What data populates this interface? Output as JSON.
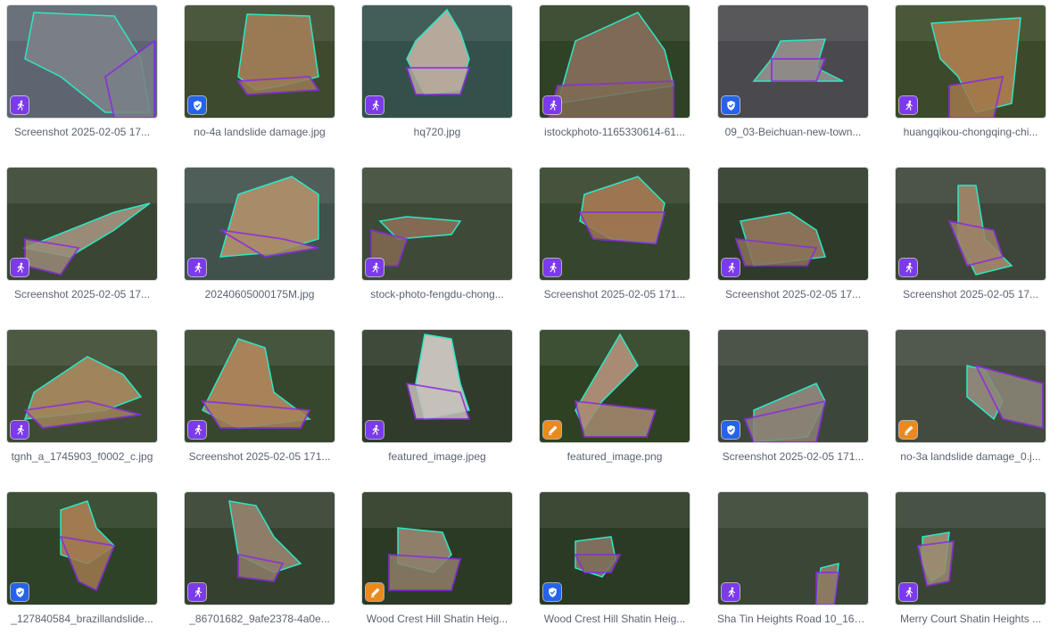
{
  "colors": {
    "annotation_badge": "#7c3aed",
    "reviewed_badge": "#2563eb",
    "edit_badge": "#ea8a1e",
    "outline_teal": "#2ee6c4",
    "outline_purple": "#8b2be2"
  },
  "items": [
    {
      "name": "Screenshot 2025-02-05 17...",
      "status": "annotate",
      "icon": "running-person-icon",
      "bg": "#5d6570",
      "scene": "#7a7f86"
    },
    {
      "name": "no-4a landslide damage.jpg",
      "status": "reviewed",
      "icon": "shield-check-icon",
      "bg": "#3d4a2e",
      "scene": "#9a7a55"
    },
    {
      "name": "hq720.jpg",
      "status": "annotate",
      "icon": "running-person-icon",
      "bg": "#33504a",
      "scene": "#b6a89a"
    },
    {
      "name": "istockphoto-1165330614-61...",
      "status": "annotate",
      "icon": "running-person-icon",
      "bg": "#2f4226",
      "scene": "#7f6a55"
    },
    {
      "name": "09_03-Beichuan-new-town...",
      "status": "reviewed",
      "icon": "shield-check-icon",
      "bg": "#4a4a4e",
      "scene": "#8d8a88"
    },
    {
      "name": "huangqikou-chongqing-chi...",
      "status": "annotate",
      "icon": "running-person-icon",
      "bg": "#3b4a2a",
      "scene": "#a27a4c"
    },
    {
      "name": "Screenshot 2025-02-05 17...",
      "status": "annotate",
      "icon": "running-person-icon",
      "bg": "#3a4633",
      "scene": "#9a8a78"
    },
    {
      "name": "20240605000175M.jpg",
      "status": "annotate",
      "icon": "running-person-icon",
      "bg": "#41514b",
      "scene": "#a88b68"
    },
    {
      "name": "stock-photo-fengdu-chong...",
      "status": "annotate",
      "icon": "running-person-icon",
      "bg": "#3e4a38",
      "scene": "#846a52"
    },
    {
      "name": "Screenshot 2025-02-05 171...",
      "status": "annotate",
      "icon": "running-person-icon",
      "bg": "#36452d",
      "scene": "#9c7650"
    },
    {
      "name": "Screenshot 2025-02-05 17...",
      "status": "annotate",
      "icon": "running-person-icon",
      "bg": "#2f3b2a",
      "scene": "#8a7258"
    },
    {
      "name": "Screenshot 2025-02-05 17...",
      "status": "annotate",
      "icon": "running-person-icon",
      "bg": "#3d4639",
      "scene": "#9b8266"
    },
    {
      "name": "tgnh_a_1745903_f0002_c.jpg",
      "status": "annotate",
      "icon": "running-person-icon",
      "bg": "#3e4b33",
      "scene": "#a0845c"
    },
    {
      "name": "Screenshot 2025-02-05 171...",
      "status": "annotate",
      "icon": "running-person-icon",
      "bg": "#37472e",
      "scene": "#a88258"
    },
    {
      "name": "featured_image.jpeg",
      "status": "annotate",
      "icon": "running-person-icon",
      "bg": "#2f3b2b",
      "scene": "#c5c0b9"
    },
    {
      "name": "featured_image.png",
      "status": "edit",
      "icon": "pencil-icon",
      "bg": "#2e4223",
      "scene": "#a88b72"
    },
    {
      "name": "Screenshot 2025-02-05 171...",
      "status": "reviewed",
      "icon": "shield-check-icon",
      "bg": "#3d463b",
      "scene": "#8a8276"
    },
    {
      "name": "no-3a landslide damage_0.j...",
      "status": "edit",
      "icon": "pencil-icon",
      "bg": "#434a3e",
      "scene": "#8c8678"
    },
    {
      "name": "_127840584_brazillandslide...",
      "status": "reviewed",
      "icon": "shield-check-icon",
      "bg": "#2e4227",
      "scene": "#a07a50"
    },
    {
      "name": "_86701682_9afe2378-4a0e...",
      "status": "annotate",
      "icon": "running-person-icon",
      "bg": "#35412f",
      "scene": "#8e7d68"
    },
    {
      "name": "Wood Crest Hill Shatin Heig...",
      "status": "edit",
      "icon": "pencil-icon",
      "bg": "#2b3a24",
      "scene": "#8f7f6a"
    },
    {
      "name": "Wood Crest Hill Shatin Heig...",
      "status": "reviewed",
      "icon": "shield-check-icon",
      "bg": "#2b3a24",
      "scene": "#7e6e5b"
    },
    {
      "name": "Sha Tin Heights Road 10_16_...",
      "status": "annotate",
      "icon": "running-person-icon",
      "bg": "#3a4636",
      "scene": "#8b7a62"
    },
    {
      "name": "Merry Court Shatin Heights ...",
      "status": "annotate",
      "icon": "running-person-icon",
      "bg": "#384535",
      "scene": "#9a8a70"
    }
  ]
}
